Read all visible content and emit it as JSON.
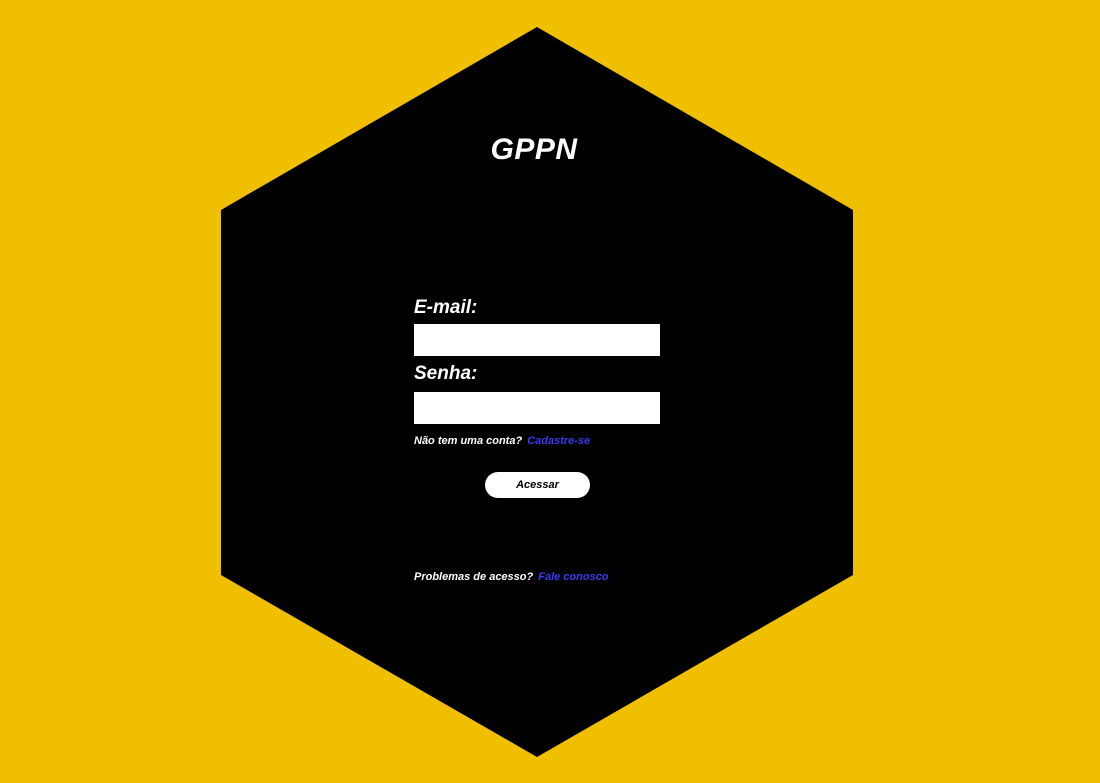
{
  "app": {
    "title": "GPPN"
  },
  "theme": {
    "background": "#F0C000",
    "panel": "#000000",
    "text": "#FFFFFF",
    "link": "#3B3BF0"
  },
  "login": {
    "email_label": "E-mail:",
    "email_value": "",
    "password_label": "Senha:",
    "password_value": "",
    "signup_prompt": "Não tem uma conta?",
    "signup_link": "Cadastre-se",
    "submit_label": "Acessar"
  },
  "support": {
    "prompt": "Problemas de acesso?",
    "link": "Fale conosco"
  }
}
